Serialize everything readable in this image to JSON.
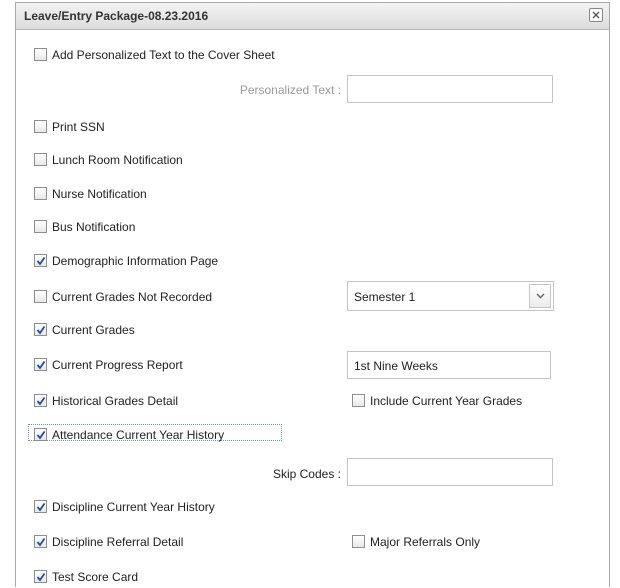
{
  "dialog": {
    "title": "Leave/Entry Package-08.23.2016",
    "close_icon": "close-icon"
  },
  "options": {
    "add_personalized_text": {
      "label": "Add Personalized Text to the Cover Sheet",
      "checked": false
    },
    "personalized_text": {
      "label": "Personalized Text :",
      "value": ""
    },
    "print_ssn": {
      "label": "Print SSN",
      "checked": false
    },
    "lunch_room_notification": {
      "label": "Lunch Room Notification",
      "checked": false
    },
    "nurse_notification": {
      "label": "Nurse Notification",
      "checked": false
    },
    "bus_notification": {
      "label": "Bus Notification",
      "checked": false
    },
    "demographic_information_page": {
      "label": "Demographic Information Page",
      "checked": true
    },
    "current_grades_not_recorded": {
      "label": "Current Grades Not Recorded",
      "checked": false
    },
    "semester_select": {
      "value": "Semester 1"
    },
    "current_grades": {
      "label": "Current Grades",
      "checked": true
    },
    "current_progress_report": {
      "label": "Current Progress Report",
      "checked": true
    },
    "progress_period": {
      "value": "1st Nine Weeks"
    },
    "historical_grades_detail": {
      "label": "Historical Grades Detail",
      "checked": true
    },
    "include_current_year_grades": {
      "label": "Include Current Year Grades",
      "checked": false
    },
    "attendance_current_year_history": {
      "label": "Attendance Current Year History",
      "checked": true
    },
    "skip_codes": {
      "label": "Skip Codes :",
      "value": ""
    },
    "discipline_current_year_history": {
      "label": "Discipline Current Year History",
      "checked": true
    },
    "discipline_referral_detail": {
      "label": "Discipline Referral Detail",
      "checked": true
    },
    "major_referrals_only": {
      "label": "Major Referrals Only",
      "checked": false
    },
    "test_score_card": {
      "label": "Test Score Card",
      "checked": true
    }
  }
}
